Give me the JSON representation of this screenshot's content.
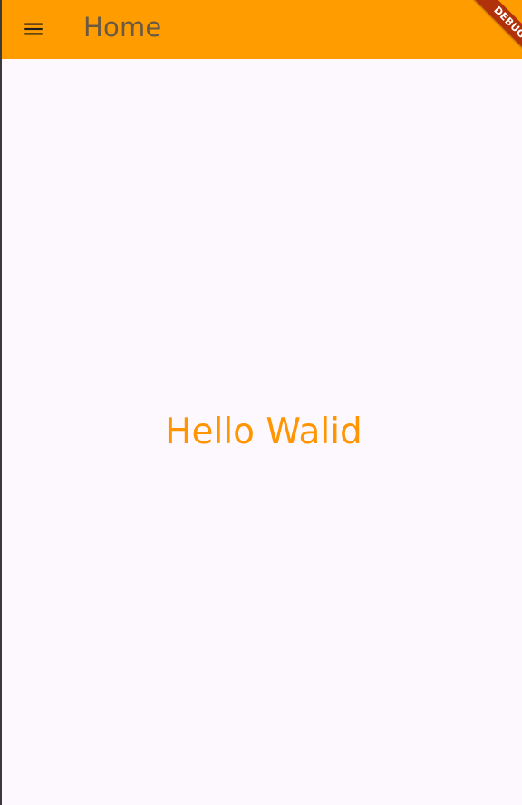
{
  "app_bar": {
    "title": "Home",
    "menu_icon": "menu-icon",
    "background_color": "#ff9d00",
    "title_color": "#6b5a43"
  },
  "debug_banner": {
    "label": "DEBUG",
    "color": "#b1320a"
  },
  "body": {
    "greeting": "Hello Walid",
    "greeting_color": "#ff9500",
    "background_color": "#fdf8fd"
  }
}
